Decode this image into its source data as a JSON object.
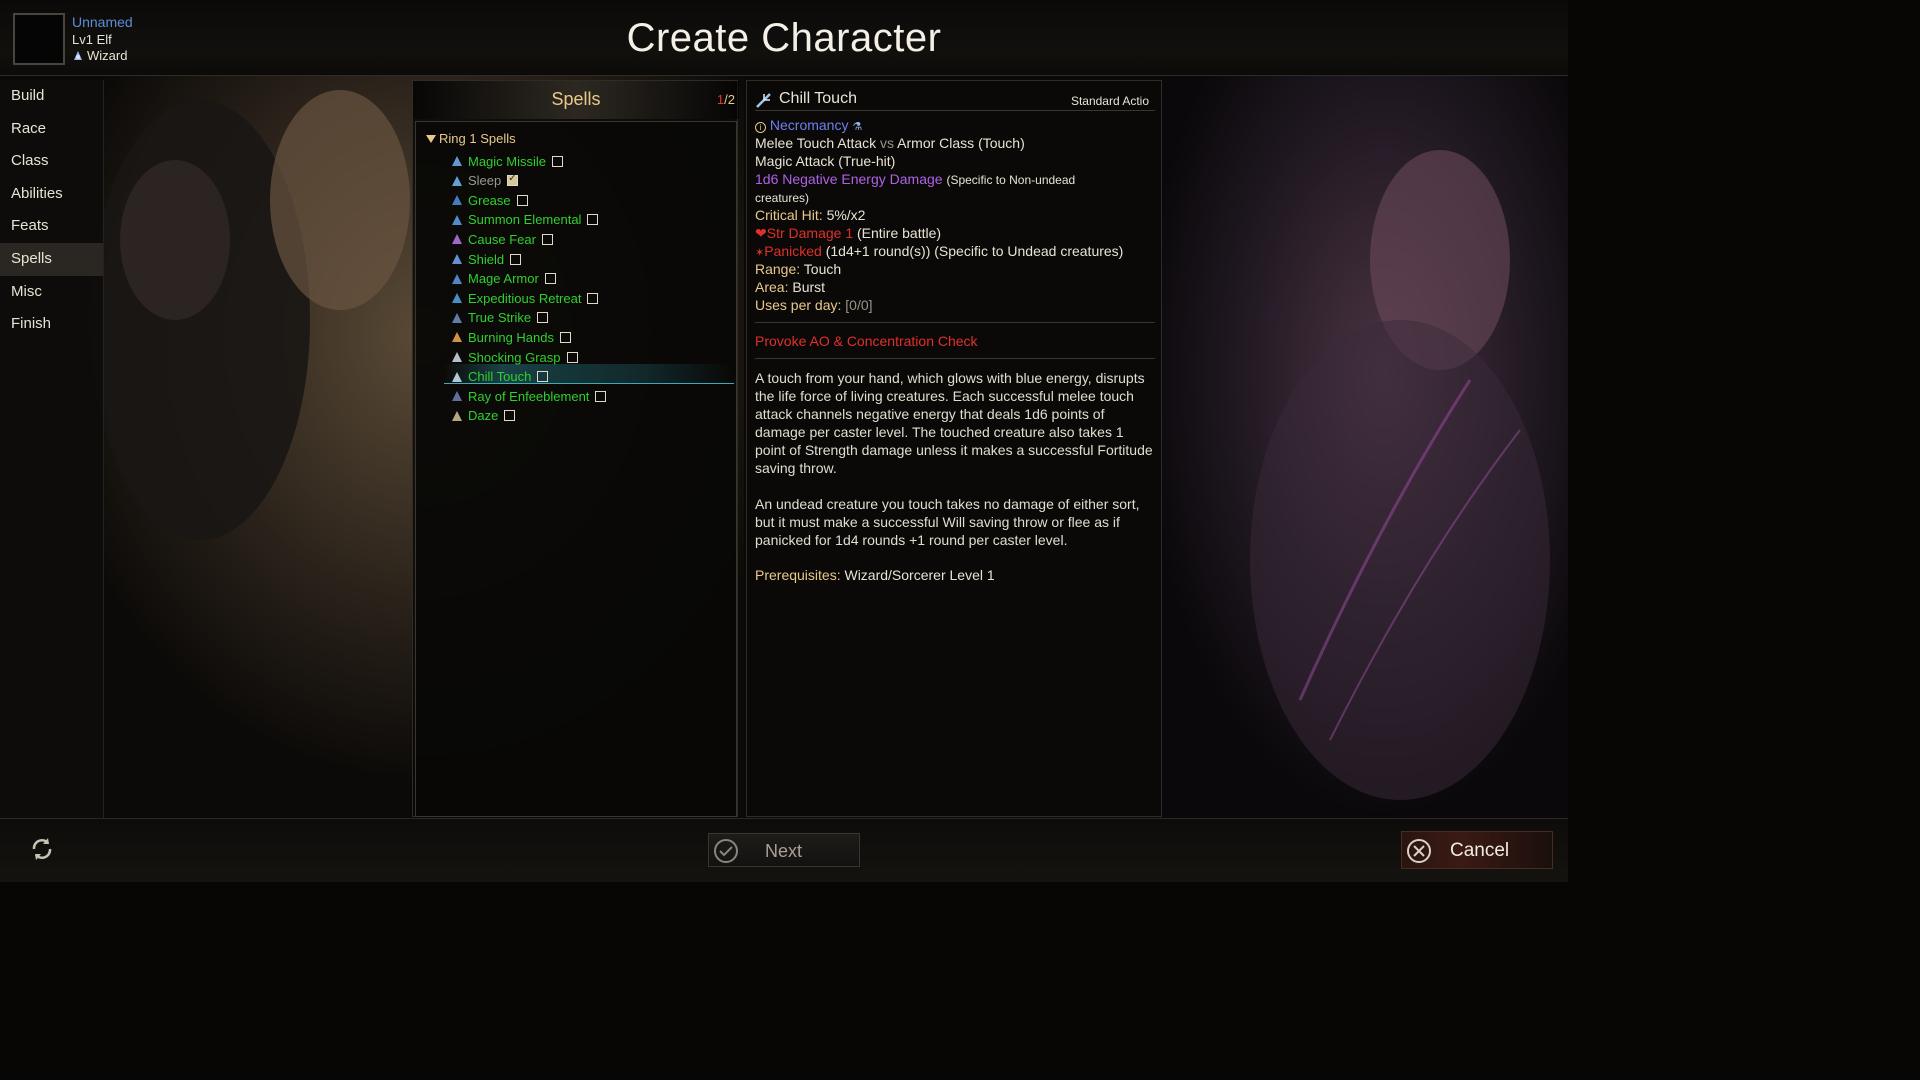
{
  "character": {
    "name": "Unnamed",
    "level_prefix": "Lv1",
    "race": "Elf",
    "class": "Wizard"
  },
  "title": "Create Character",
  "sidebar": {
    "items": [
      {
        "label": "Build"
      },
      {
        "label": "Race"
      },
      {
        "label": "Class"
      },
      {
        "label": "Abilities"
      },
      {
        "label": "Feats"
      },
      {
        "label": "Spells"
      },
      {
        "label": "Misc"
      },
      {
        "label": "Finish"
      }
    ],
    "active": "Spells"
  },
  "spells_panel": {
    "title": "Spells",
    "count_current": "1",
    "count_sep": "/",
    "count_max": "2",
    "ring_header": "Ring 1 Spells",
    "spells": [
      {
        "name": "Magic Missile",
        "icon": "magic-missile-icon",
        "checked": false,
        "disabled": false
      },
      {
        "name": "Sleep",
        "icon": "sleep-icon",
        "checked": true,
        "disabled": true
      },
      {
        "name": "Grease",
        "icon": "grease-icon",
        "checked": false,
        "disabled": false
      },
      {
        "name": "Summon Elemental",
        "icon": "summon-elemental-icon",
        "checked": false,
        "disabled": false
      },
      {
        "name": "Cause Fear",
        "icon": "cause-fear-icon",
        "checked": false,
        "disabled": false
      },
      {
        "name": "Shield",
        "icon": "shield-icon",
        "checked": false,
        "disabled": false
      },
      {
        "name": "Mage Armor",
        "icon": "mage-armor-icon",
        "checked": false,
        "disabled": false
      },
      {
        "name": "Expeditious Retreat",
        "icon": "expeditious-retreat-icon",
        "checked": false,
        "disabled": false
      },
      {
        "name": "True Strike",
        "icon": "true-strike-icon",
        "checked": false,
        "disabled": false
      },
      {
        "name": "Burning Hands",
        "icon": "burning-hands-icon",
        "checked": false,
        "disabled": false
      },
      {
        "name": "Shocking Grasp",
        "icon": "shocking-grasp-icon",
        "checked": false,
        "disabled": false
      },
      {
        "name": "Chill Touch",
        "icon": "chill-touch-icon",
        "checked": false,
        "disabled": false,
        "selected": true
      },
      {
        "name": "Ray of Enfeeblement",
        "icon": "ray-of-enfeeblement-icon",
        "checked": false,
        "disabled": false
      },
      {
        "name": "Daze",
        "icon": "daze-icon",
        "checked": false,
        "disabled": false
      }
    ]
  },
  "detail": {
    "name": "Chill Touch",
    "action_type": "Standard Actio",
    "school": "Necromancy",
    "attack_line": {
      "a": "Melee Touch Attack",
      "vs": "vs",
      "b": "Armor Class (Touch)"
    },
    "magic_attack": "Magic Attack (True-hit)",
    "damage": "1d6 Negative Energy Damage",
    "damage_note": "(Specific to Non-undead",
    "damage_note2": "creatures)",
    "crit_label": "Critical Hit:",
    "crit_value": "5%/x2",
    "str_damage": "Str Damage 1",
    "str_damage_note": "(Entire battle)",
    "panicked": "Panicked",
    "panicked_note": "(1d4+1 round(s)) (Specific to Undead creatures)",
    "range_label": "Range:",
    "range_value": "Touch",
    "area_label": "Area:",
    "area_value": "Burst",
    "uses_label": "Uses per day:",
    "uses_value": "[0/0]",
    "provoke": "Provoke AO & Concentration Check",
    "description_1": "A touch from your hand, which glows with blue energy, disrupts the life force of living creatures. Each successful melee touch attack channels negative energy that deals 1d6 points of damage per caster level. The touched creature also takes 1 point of Strength damage unless it makes a successful Fortitude saving throw.",
    "description_2": "An undead creature you touch takes no damage of either sort, but it must make a successful Will saving throw or flee as if panicked for 1d4 rounds +1 round per caster level.",
    "prereq_label": "Prerequisites:",
    "prereq_value": "Wizard/Sorcerer Level 1"
  },
  "buttons": {
    "next": "Next",
    "cancel": "Cancel"
  },
  "colors": {
    "accent_gold": "#e9c98a",
    "spell_green": "#2fd02f",
    "school_blue": "#6d7ff0",
    "damage_purple": "#b060e8",
    "warning_red": "#e0302a"
  }
}
